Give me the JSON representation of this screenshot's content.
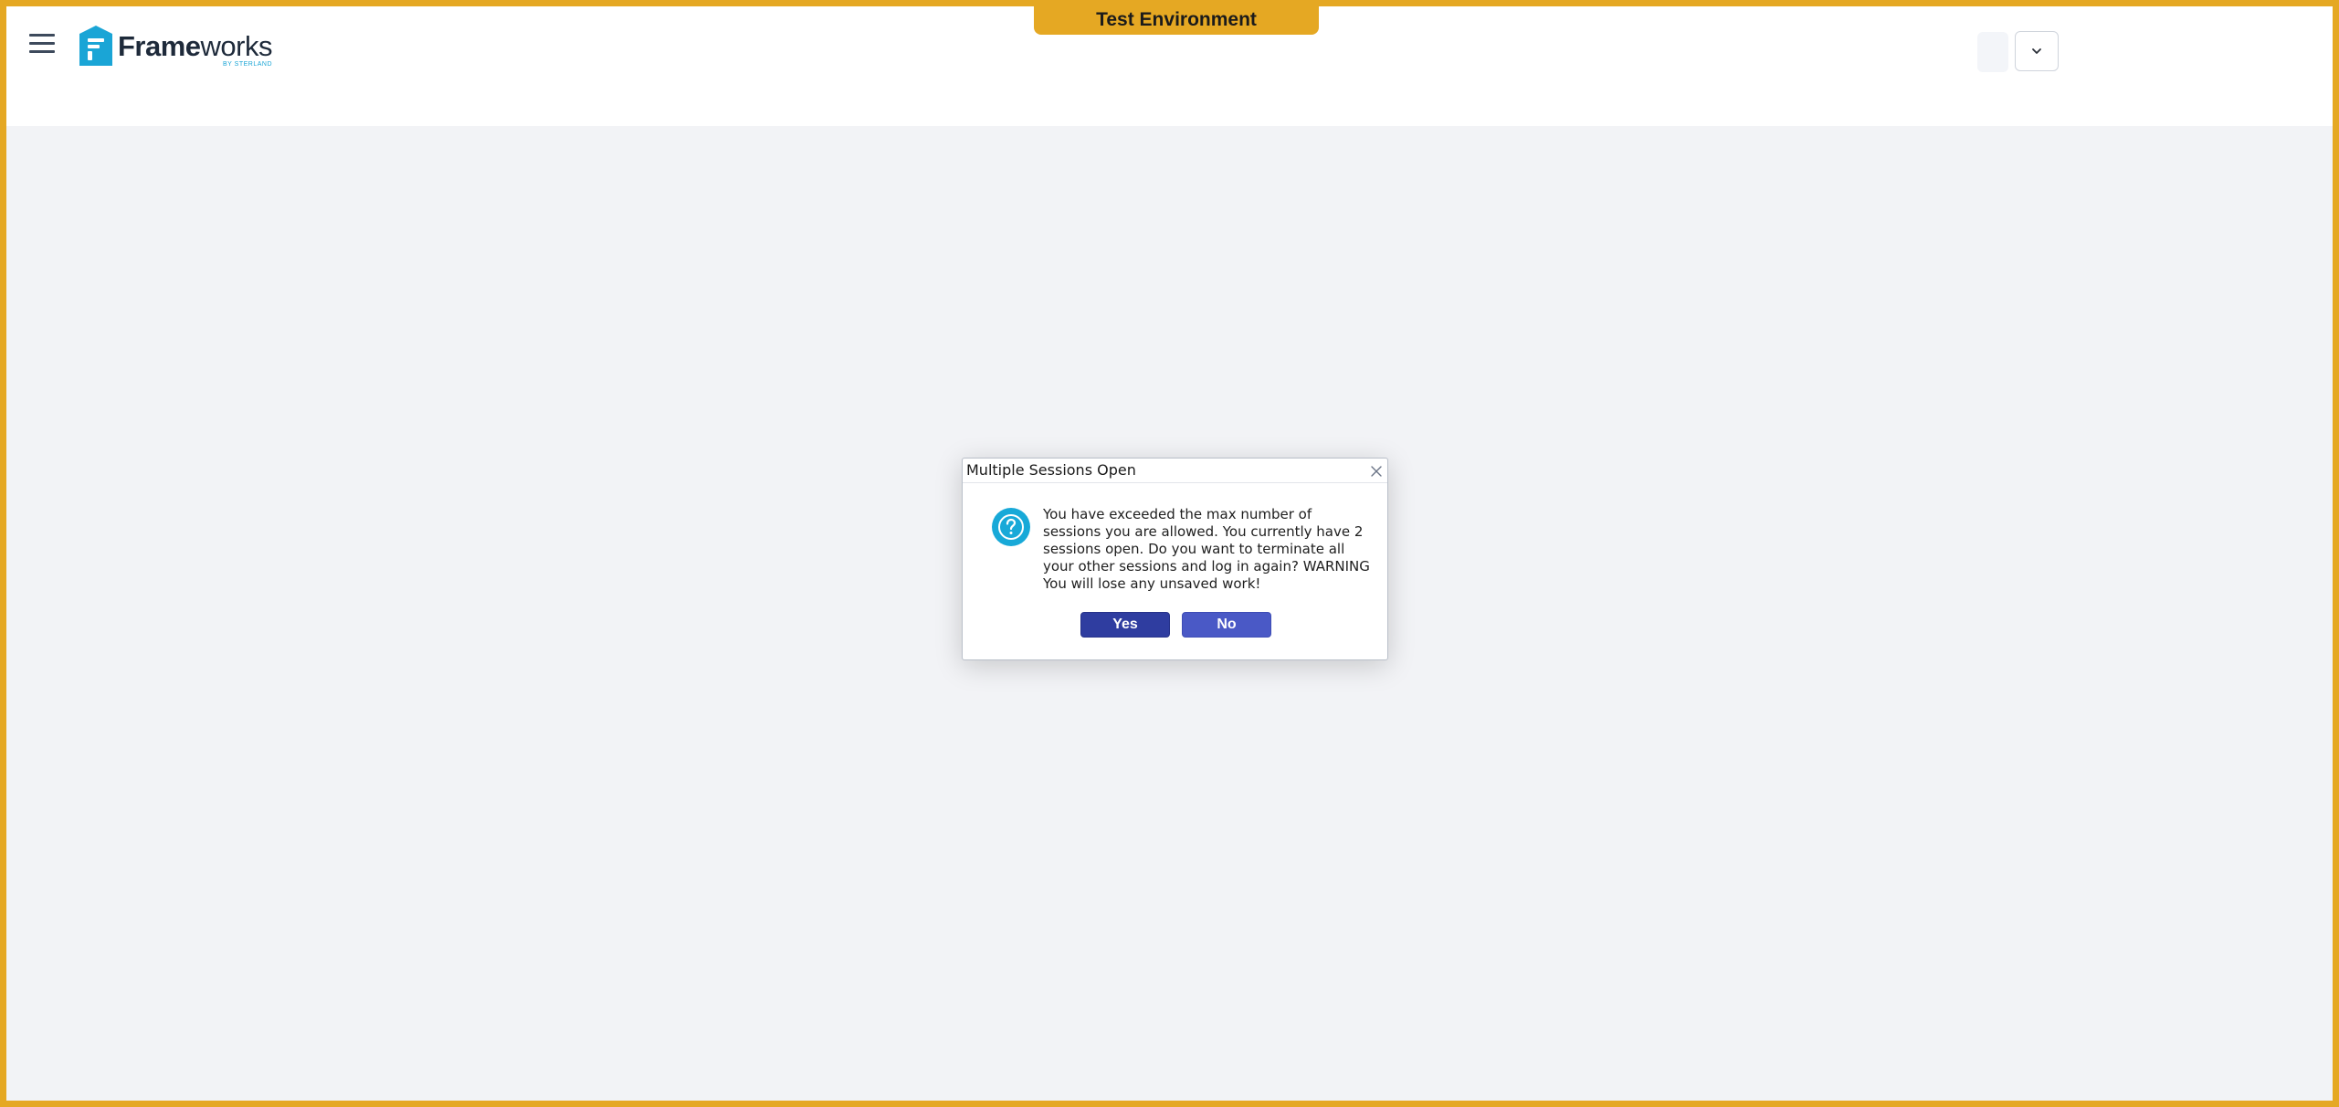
{
  "environment_banner": "Test Environment",
  "logo": {
    "name_bold": "Frame",
    "name_regular": "works",
    "tagline": "BY STERLAND"
  },
  "icons": {
    "menu": "hamburger-menu-icon",
    "dropdown": "chevron-down-icon",
    "close": "close-icon",
    "question": "question-icon"
  },
  "colors": {
    "frame_border": "#e5a823",
    "yes_button": "#2f3da0",
    "no_button": "#4a59c6",
    "question_icon": "#18a9d8",
    "logo_brand": "#1aa5d6"
  },
  "dialog": {
    "title": "Multiple Sessions Open",
    "message": "You have exceeded the max number of sessions you are allowed. You currently have 2 sessions open. Do you want to terminate all your other sessions and log in again? WARNING You will lose any unsaved work!",
    "yes_label": "Yes",
    "no_label": "No"
  }
}
